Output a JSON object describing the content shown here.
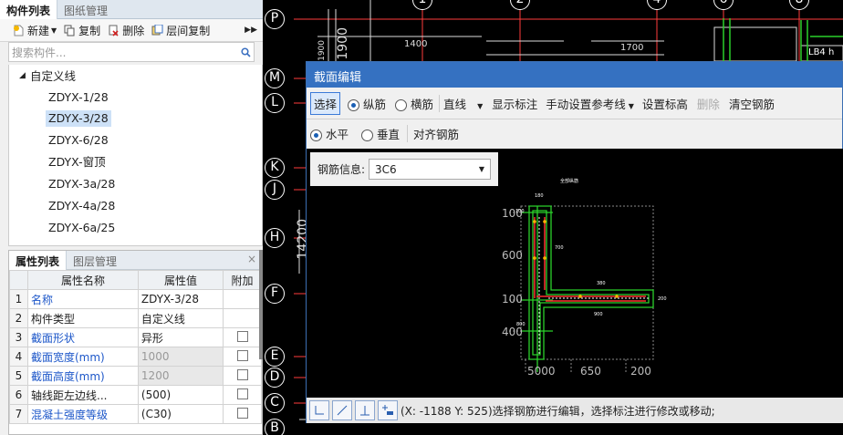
{
  "left_tabs": {
    "tab1": "构件列表",
    "tab2": "图纸管理"
  },
  "toolbar": {
    "new": "新建",
    "copy": "复制",
    "delete": "删除",
    "layer_copy": "层间复制"
  },
  "search": {
    "placeholder": "搜索构件..."
  },
  "tree": {
    "root": "自定义线",
    "items": [
      "ZDYX-1/28",
      "ZDYX-3/28",
      "ZDYX-6/28",
      "ZDYX-窗顶",
      "ZDYX-3a/28",
      "ZDYX-4a/28",
      "ZDYX-6a/25"
    ],
    "selected_index": 1
  },
  "props_tabs": {
    "tab1": "属性列表",
    "tab2": "图层管理"
  },
  "props": {
    "headers": [
      "属性名称",
      "属性值",
      "附加"
    ],
    "rows": [
      {
        "n": "1",
        "name": "名称",
        "value": "ZDYX-3/28"
      },
      {
        "n": "2",
        "name": "构件类型",
        "value": "自定义线"
      },
      {
        "n": "3",
        "name": "截面形状",
        "value": "异形"
      },
      {
        "n": "4",
        "name": "截面宽度(mm)",
        "value": "1000"
      },
      {
        "n": "5",
        "name": "截面高度(mm)",
        "value": "1200"
      },
      {
        "n": "6",
        "name": "轴线距左边线...",
        "value": "(500)"
      },
      {
        "n": "7",
        "name": "混凝土强度等级",
        "value": "(C30)"
      }
    ]
  },
  "axes": [
    "P",
    "M",
    "L",
    "K",
    "J",
    "H",
    "F",
    "E",
    "D",
    "C",
    "B"
  ],
  "top_axes": [
    "1",
    "2",
    "4",
    "6",
    "8"
  ],
  "cad_texts": {
    "d1400": "1400",
    "d1700": "1700",
    "d1900": "1900",
    "d1900b": "1900",
    "d14200": "14200",
    "lb4": "LB4 h"
  },
  "dialog": {
    "title": "截面编辑",
    "select_btn": "选择",
    "radio_long": "纵筋",
    "radio_hoop": "横筋",
    "line_type": "直线",
    "show_dim": "显示标注",
    "manual_ref": "手动设置参考线",
    "set_elev": "设置标高",
    "delete": "删除",
    "clear": "清空钢筋",
    "horizontal": "水平",
    "vertical": "垂直",
    "align": "对齐钢筋",
    "rebar_info_label": "钢筋信息:",
    "rebar_info_value": "3C6",
    "status": "(X: -1188 Y: 525)选择钢筋进行编辑，选择标注进行修改或移动;",
    "dims": {
      "d100a": "100",
      "d600": "600",
      "d100b": "100",
      "d400": "400",
      "d5000": "5000",
      "d650": "650",
      "d200": "200",
      "d180": "180",
      "d100c": "100",
      "d700": "700",
      "d380": "380",
      "d900": "900",
      "d800": "800",
      "d200b": "200"
    },
    "hint": "全部纵筋"
  }
}
